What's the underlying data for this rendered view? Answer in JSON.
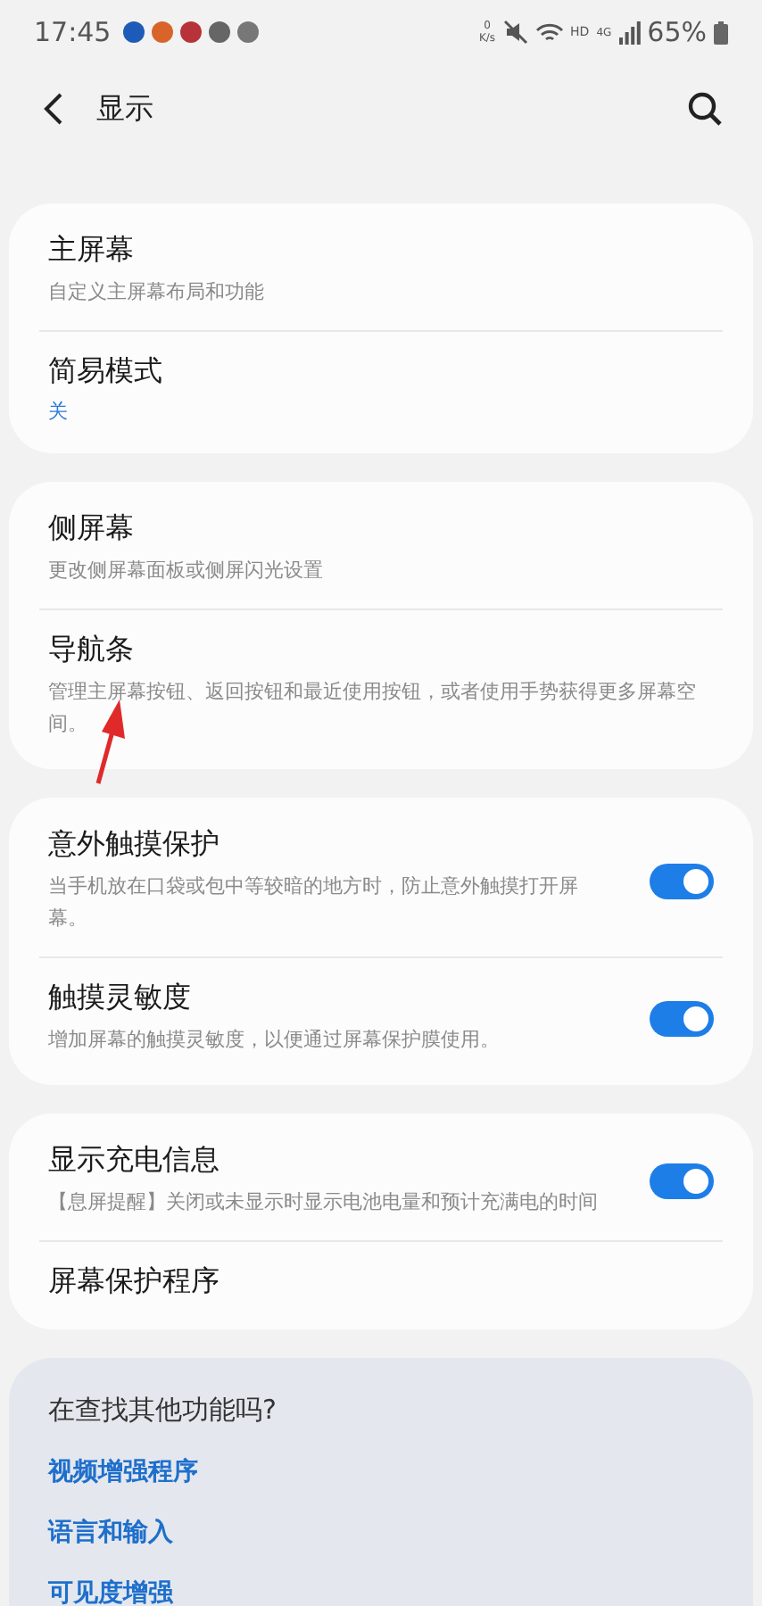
{
  "status_bar": {
    "time": "17:45",
    "notification_icons": [
      {
        "color": "#1e5bb8"
      },
      {
        "color": "#d9642a"
      },
      {
        "color": "#b8323a"
      },
      {
        "color": "#666666"
      },
      {
        "color": "#777777"
      }
    ],
    "net_speed_value": "0",
    "net_speed_unit": "K/s",
    "hd": "HD",
    "network": "4G",
    "battery": "65%"
  },
  "header": {
    "title": "显示"
  },
  "groups": [
    {
      "items": [
        {
          "kind": "plain",
          "title": "主屏幕",
          "subtitle": "自定义主屏幕布局和功能"
        },
        {
          "kind": "value",
          "title": "简易模式",
          "value": "关"
        }
      ]
    },
    {
      "items": [
        {
          "kind": "plain",
          "title": "侧屏幕",
          "subtitle": "更改侧屏幕面板或侧屏闪光设置"
        },
        {
          "kind": "plain",
          "title": "导航条",
          "subtitle": "管理主屏幕按钮、返回按钮和最近使用按钮，或者使用手势获得更多屏幕空间。"
        }
      ]
    },
    {
      "items": [
        {
          "kind": "switch",
          "title": "意外触摸保护",
          "subtitle": "当手机放在口袋或包中等较暗的地方时，防止意外触摸打开屏幕。",
          "on": true
        },
        {
          "kind": "switch",
          "title": "触摸灵敏度",
          "subtitle": "增加屏幕的触摸灵敏度，以便通过屏幕保护膜使用。",
          "on": true
        }
      ]
    },
    {
      "items": [
        {
          "kind": "switch",
          "title": "显示充电信息",
          "subtitle": "【息屏提醒】关闭或未显示时显示电池电量和预计充满电的时间",
          "on": true
        },
        {
          "kind": "plain",
          "title": "屏幕保护程序"
        }
      ]
    }
  ],
  "suggestions": {
    "title": "在查找其他功能吗?",
    "links": [
      "视频增强程序",
      "语言和输入",
      "可见度增强"
    ]
  }
}
